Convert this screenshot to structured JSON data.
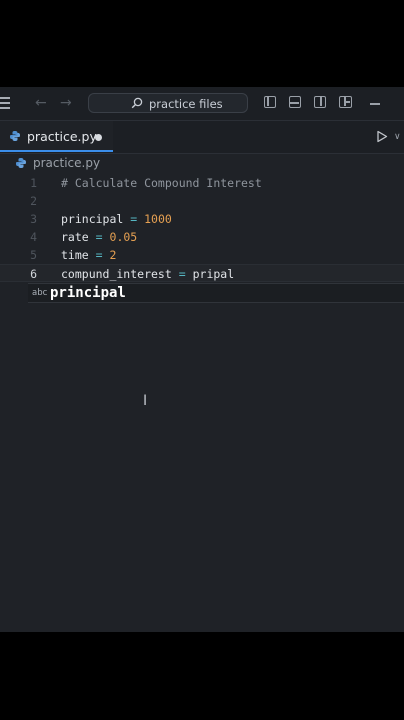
{
  "titlebar": {
    "search_placeholder": "practice files",
    "icons": [
      "menu-icon",
      "back-arrow-icon",
      "forward-arrow-icon",
      "search-icon",
      "toggle-primary-sidebar-icon",
      "toggle-panel-icon",
      "toggle-secondary-sidebar-icon",
      "customize-layout-icon",
      "minimize-icon"
    ]
  },
  "tab": {
    "label": "practice.py",
    "dirty": true,
    "icon": "python-file-icon"
  },
  "breadcrumb": {
    "file": "practice.py"
  },
  "editor": {
    "active_line": 6,
    "lines": [
      {
        "num": "1",
        "text": "# Calculate Compound Interest"
      },
      {
        "num": "2",
        "text": ""
      },
      {
        "num": "3",
        "var": "principal",
        "op": "=",
        "val": "1000"
      },
      {
        "num": "4",
        "var": "rate",
        "op": "=",
        "val": "0.05"
      },
      {
        "num": "5",
        "var": "time",
        "op": "=",
        "val": "2"
      },
      {
        "num": "6",
        "var": "compund_interest",
        "op": "=",
        "rest": "pripal"
      }
    ]
  },
  "suggestion": {
    "kind": "abc",
    "label": "principal"
  },
  "colors": {
    "accent": "#3b8eea",
    "number": "#e5a052",
    "operator": "#56b6c2",
    "comment": "#8f959d"
  }
}
